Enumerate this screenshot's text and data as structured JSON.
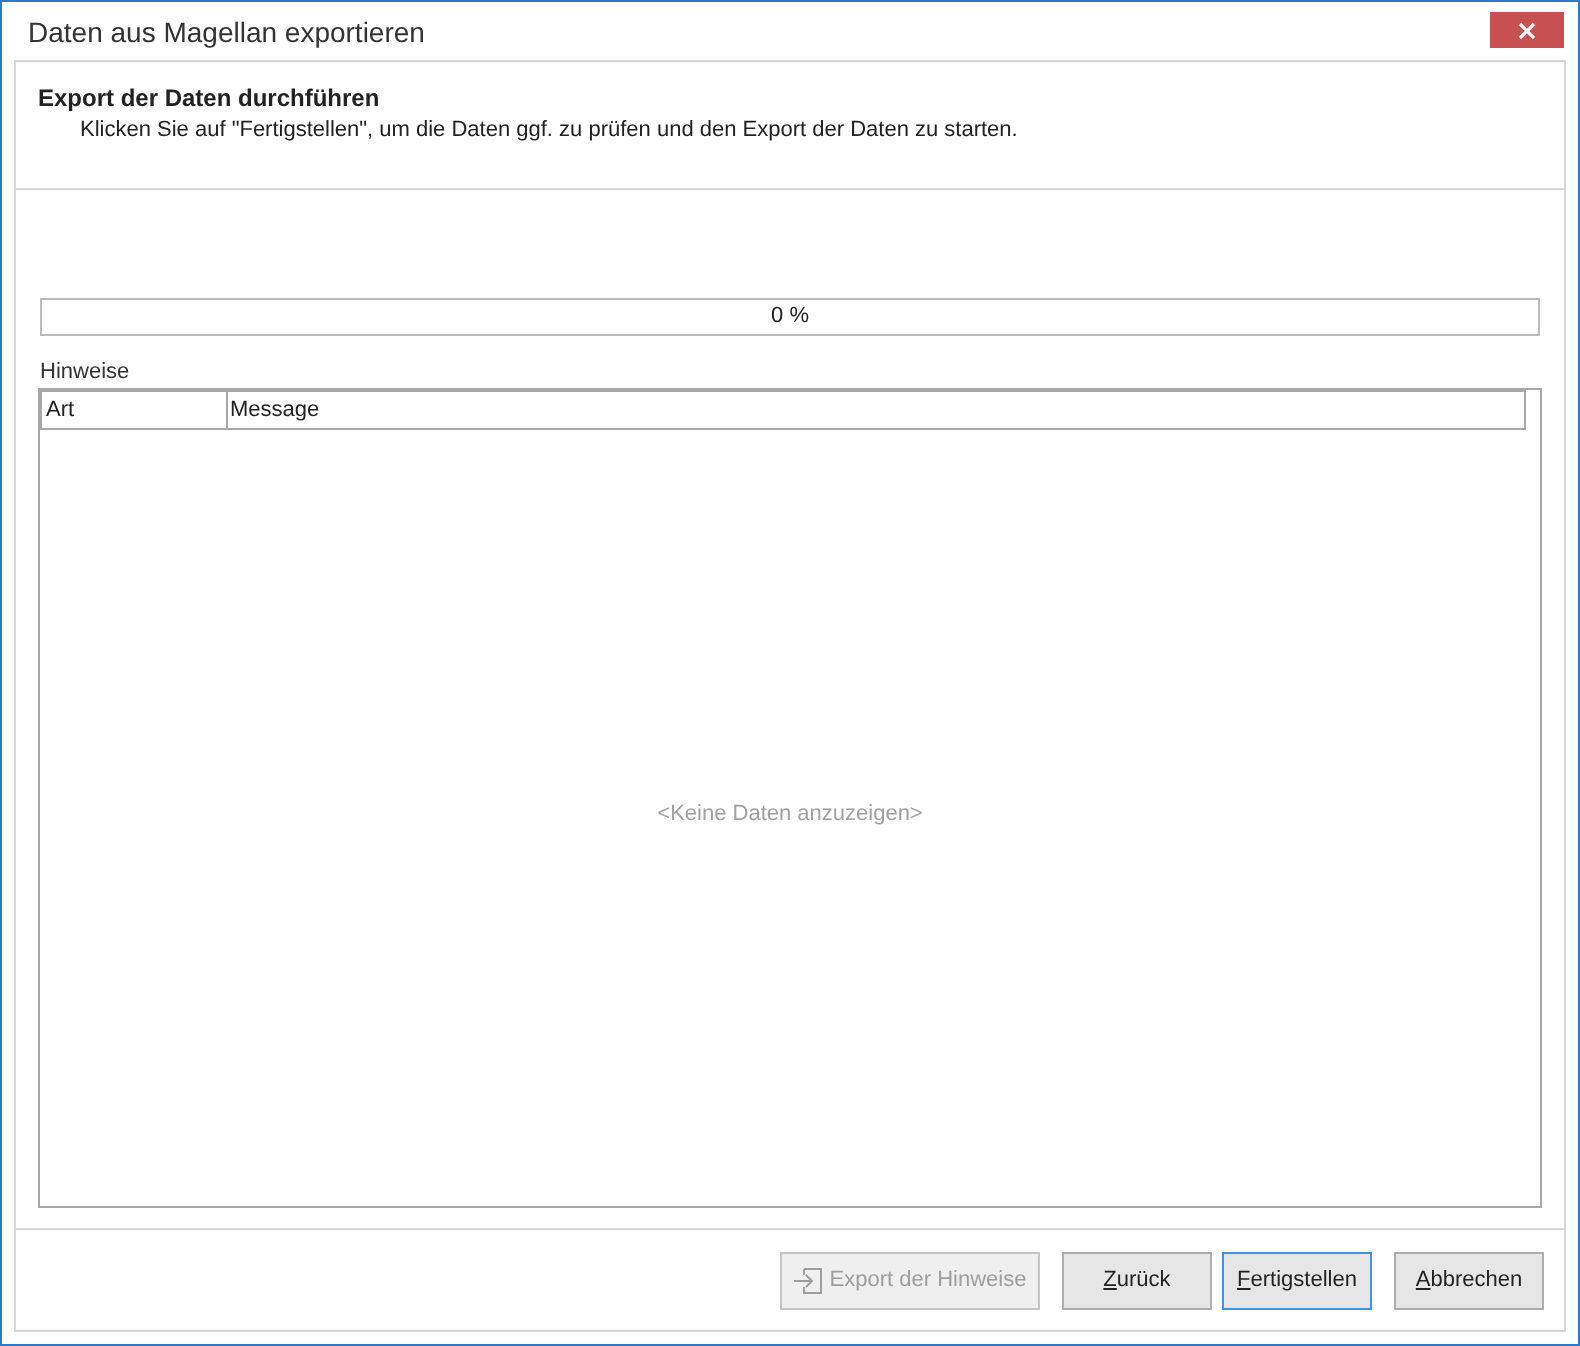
{
  "window": {
    "title": "Daten aus Magellan exportieren"
  },
  "header": {
    "title": "Export der Daten durchführen",
    "description": "Klicken Sie auf \"Fertigstellen\", um die Daten ggf. zu prüfen und den Export der Daten zu starten."
  },
  "progress": {
    "level": 0,
    "reading": "0 %"
  },
  "notes": {
    "label": "Hinweise",
    "columns": [
      "Art",
      "Message"
    ],
    "empty_text": "<Keine Daten anzuzeigen>"
  },
  "buttons": [
    {
      "label": "Export der Hinweise",
      "kind": "icon",
      "disabled": true,
      "focused": false,
      "mnemonic": false
    },
    {
      "label": "Zurück",
      "kind": "text",
      "disabled": false,
      "focused": false,
      "mnemonic": true
    },
    {
      "label": "Fertigstellen",
      "kind": "text",
      "disabled": false,
      "focused": true,
      "mnemonic": true
    },
    {
      "label": "Abbrechen",
      "kind": "text",
      "disabled": false,
      "focused": false,
      "mnemonic": true
    }
  ]
}
